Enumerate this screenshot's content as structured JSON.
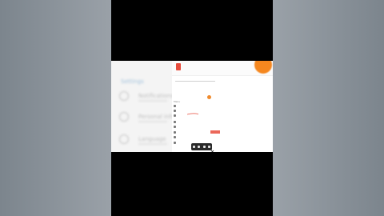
{
  "layout": "vertical-video-letterbox",
  "background_screen": {
    "title": "Settings",
    "rows": [
      {
        "label": "Notifications",
        "icon": "circle-icon"
      },
      {
        "label": "Personal info",
        "icon": "circle-icon"
      },
      {
        "label": "Language",
        "icon": "circle-icon"
      }
    ]
  },
  "panel": {
    "top_text": "",
    "search_placeholder": "",
    "menu_header": "Menu",
    "items": [
      {
        "label": "",
        "icon": "item-icon"
      },
      {
        "label": "",
        "icon": "item-icon"
      },
      {
        "label": "",
        "icon": "item-icon"
      },
      {
        "label": "",
        "icon": "item-icon"
      },
      {
        "label": "",
        "icon": "item-icon"
      },
      {
        "label": "",
        "icon": "item-icon"
      },
      {
        "label": "",
        "icon": "item-icon"
      },
      {
        "label": "",
        "icon": "item-icon"
      }
    ],
    "toolbar_icons": [
      "pen-icon",
      "crop-icon",
      "text-icon",
      "share-icon",
      "close-icon"
    ]
  },
  "colors": {
    "accent_orange": "#f5871f",
    "annotation_red": "#e74c3c",
    "toolbar_bg": "#2a2a2a"
  }
}
